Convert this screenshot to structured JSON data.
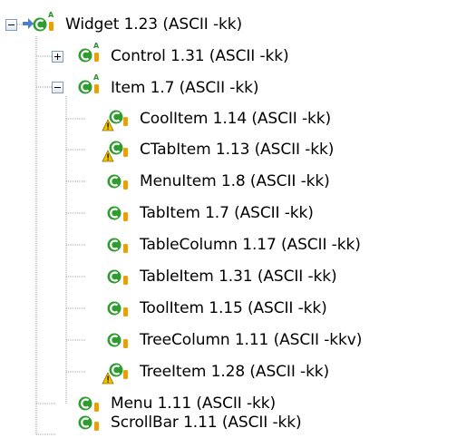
{
  "tree": {
    "root": {
      "label": "Widget 1.23 (ASCII -kk)",
      "icon": "class-icon",
      "expanded": true,
      "abstract": true,
      "incoming_arrow": true,
      "children": [
        {
          "label": "Control 1.31 (ASCII -kk)",
          "icon": "class-icon",
          "abstract": true,
          "expanded": false
        },
        {
          "label": "Item 1.7 (ASCII -kk)",
          "icon": "class-icon",
          "abstract": true,
          "expanded": true,
          "children": [
            {
              "label": "CoolItem 1.14 (ASCII -kk)",
              "icon": "class-icon",
              "warning": true
            },
            {
              "label": "CTabItem 1.13 (ASCII -kk)",
              "icon": "class-icon",
              "warning": true
            },
            {
              "label": "MenuItem 1.8 (ASCII -kk)",
              "icon": "class-icon",
              "warning": false
            },
            {
              "label": "TabItem 1.7 (ASCII -kk)",
              "icon": "class-icon",
              "warning": false
            },
            {
              "label": "TableColumn 1.17 (ASCII -kk)",
              "icon": "class-icon",
              "warning": false
            },
            {
              "label": "TableItem 1.31 (ASCII -kk)",
              "icon": "class-icon",
              "warning": false
            },
            {
              "label": "ToolItem 1.15 (ASCII -kk)",
              "icon": "class-icon",
              "warning": false
            },
            {
              "label": "TreeColumn 1.11 (ASCII -kkv)",
              "icon": "class-icon",
              "warning": false
            },
            {
              "label": "TreeItem 1.28 (ASCII -kk)",
              "icon": "class-icon",
              "warning": true
            }
          ]
        },
        {
          "label": "Menu 1.11 (ASCII -kk)",
          "icon": "class-icon",
          "warning": false
        },
        {
          "label": "ScrollBar 1.11 (ASCII -kk)",
          "icon": "class-icon",
          "warning": false
        }
      ]
    },
    "colors": {
      "class_green": "#2e9c2e",
      "version_gold": "#e8a100",
      "warning_yellow": "#f2c200",
      "tree_line": "#a0a0a0",
      "expander_border": "#7f9db9",
      "abstract_marker": "#2f8f2f",
      "arrow_blue": "#4d7fc7"
    }
  }
}
